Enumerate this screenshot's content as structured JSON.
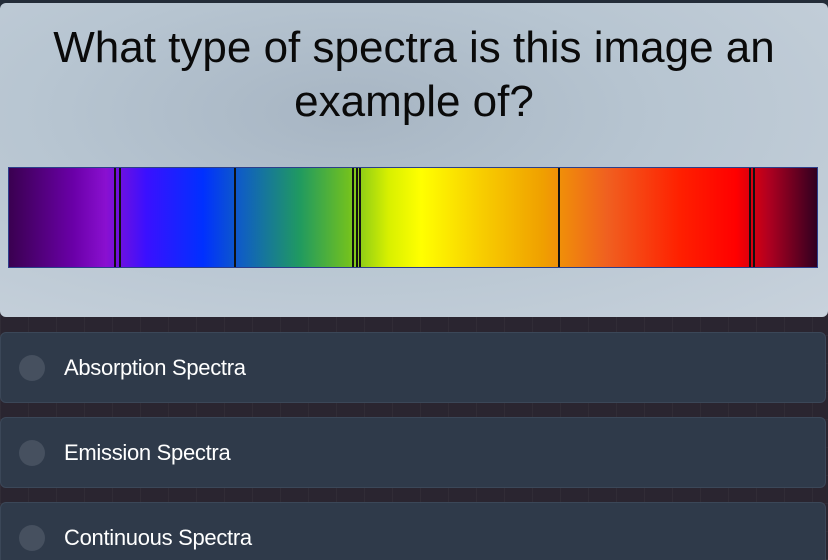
{
  "question": {
    "text": "What type of spectra is this image an example of?",
    "image": {
      "icon": "spectrum-image",
      "description_colors": [
        "#6a00a8",
        "#0030ff",
        "#209a60",
        "#ffff00",
        "#f0a000",
        "#ff0000",
        "#300020"
      ]
    }
  },
  "options": [
    {
      "label": "Absorption Spectra"
    },
    {
      "label": "Emission Spectra"
    },
    {
      "label": "Continuous Spectra"
    }
  ],
  "colors": {
    "option_background": "#2f3a4a",
    "radio": "#46505f",
    "question_text": "#0a0a0a"
  }
}
